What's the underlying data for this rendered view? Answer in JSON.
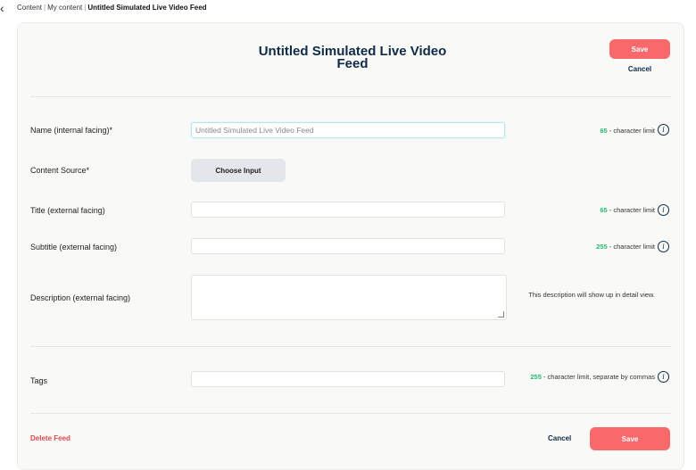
{
  "breadcrumb": {
    "back_icon": "chevron-left-icon",
    "items": [
      "Content",
      "My content"
    ],
    "current": "Untitled Simulated Live Video Feed"
  },
  "header": {
    "title": "Untitled Simulated Live Video Feed",
    "save_label": "Save",
    "cancel_label": "Cancel"
  },
  "form": {
    "name": {
      "label": "Name (internal facing)*",
      "value": "Untitled Simulated Live Video Feed",
      "limit": "65",
      "limit_text": " - character limit"
    },
    "content_source": {
      "label": "Content Source*",
      "button": "Choose Input"
    },
    "title": {
      "label": "Title (external facing)",
      "value": "",
      "limit": "65",
      "limit_text": " - character limit"
    },
    "subtitle": {
      "label": "Subtitle (external facing)",
      "value": "",
      "limit": "255",
      "limit_text": " - character limit"
    },
    "description": {
      "label": "Description (external facing)",
      "value": "",
      "note": "This description will show up in detail view."
    },
    "tags": {
      "label": "Tags",
      "value": "",
      "limit": "255",
      "limit_text": " - character limit, separate by commas"
    }
  },
  "footer": {
    "delete_label": "Delete Feed",
    "cancel_label": "Cancel",
    "save_label": "Save"
  },
  "colors": {
    "accent": "#f7696b",
    "limit": "#2bb673",
    "title": "#0e2a47",
    "danger": "#e2474b"
  }
}
